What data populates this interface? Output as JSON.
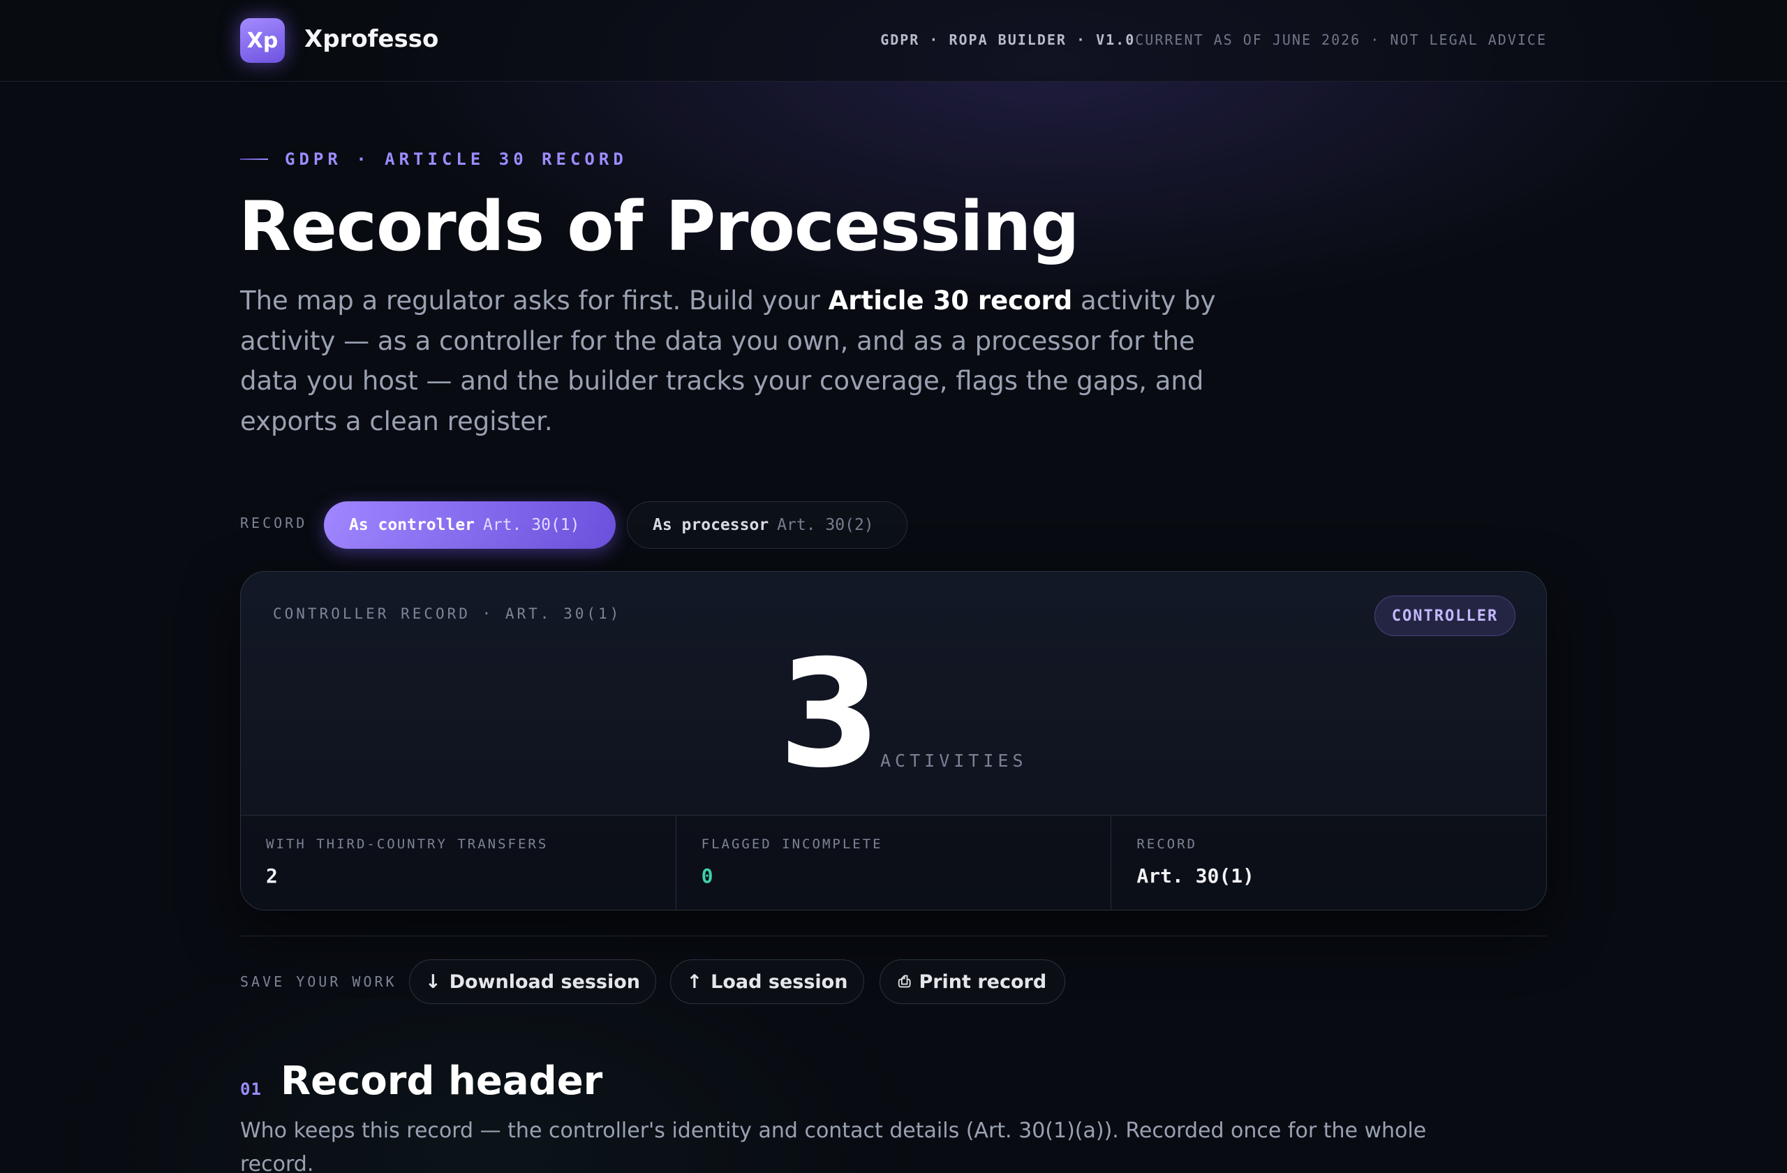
{
  "header": {
    "logo_text": "Xp",
    "brand": "Xprofesso",
    "tool": "GDPR · ROPA BUILDER · V1.0",
    "notice": "CURRENT AS OF JUNE 2026 · NOT LEGAL ADVICE"
  },
  "hero": {
    "eyebrow": "GDPR · ARTICLE 30 RECORD",
    "title": "Records of Processing",
    "lede_before": "The map a regulator asks for first. Build your ",
    "lede_bold": "Article 30 record",
    "lede_after": " activity by activity — as a controller for the data you own, and as a processor for the data you host — and the builder tracks your coverage, flags the gaps, and exports a clean register."
  },
  "record_toggle": {
    "label": "RECORD",
    "options": [
      {
        "label": "As controller",
        "sub": "Art. 30(1)",
        "selected": true
      },
      {
        "label": "As processor",
        "sub": "Art. 30(2)",
        "selected": false
      }
    ]
  },
  "summary": {
    "caption": "CONTROLLER RECORD · ART. 30(1)",
    "badge": "CONTROLLER",
    "count": "3",
    "count_unit": "ACTIVITIES",
    "stats": [
      {
        "label": "WITH THIRD-COUNTRY TRANSFERS",
        "value": "2"
      },
      {
        "label": "FLAGGED INCOMPLETE",
        "value": "0"
      },
      {
        "label": "RECORD",
        "value": "Art. 30(1)"
      }
    ]
  },
  "save": {
    "label": "SAVE YOUR WORK",
    "download": "Download session",
    "load": "Load session",
    "print": "Print record"
  },
  "section": {
    "number": "01",
    "title": "Record header",
    "description": "Who keeps this record — the controller's identity and contact details (Art. 30(1)(a)). Recorded once for the whole record."
  },
  "colors": {
    "accent": "#9c8cff",
    "accent_gradient_start": "#9f85ff",
    "accent_gradient_end": "#6d52de",
    "success": "#3fd0a8",
    "background": "#080b11"
  },
  "icons": {
    "download": "arrow-down-icon",
    "load": "arrow-up-icon",
    "print": "printer-icon"
  }
}
